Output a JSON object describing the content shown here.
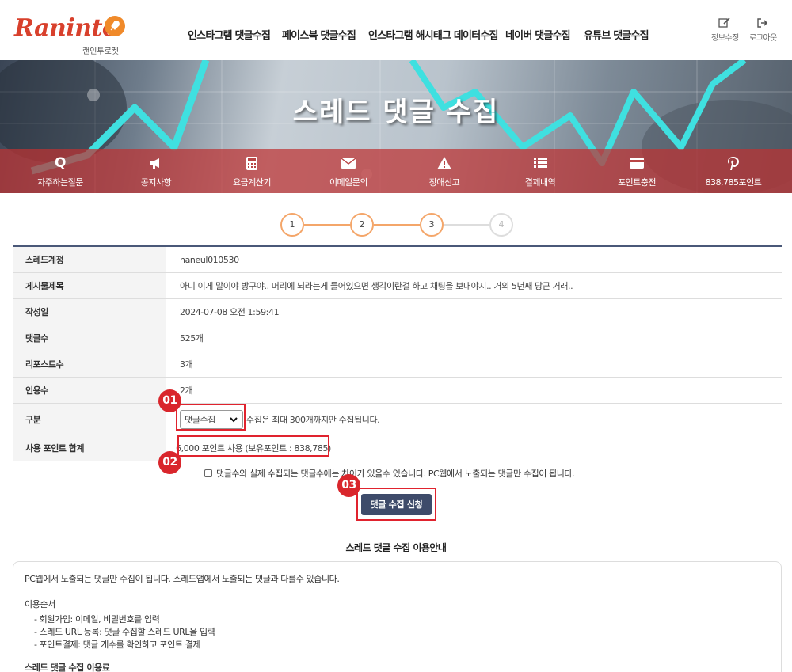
{
  "brand": {
    "logo_text": "Raninto",
    "sub_text": "랜인투로켓",
    "color": "#d8402c"
  },
  "nav": [
    "인스타그램 댓글수집",
    "페이스북 댓글수집",
    "인스타그램 해시태그 데이터수집",
    "네이버 댓글수집",
    "유튜브 댓글수집"
  ],
  "util": {
    "edit_label": "정보수정",
    "logout_label": "로그아웃"
  },
  "banner": {
    "title": "스레드 댓글 수집"
  },
  "quick_menu": [
    {
      "icon": "q-icon",
      "label": "자주하는질문"
    },
    {
      "icon": "megaphone-icon",
      "label": "공지사항"
    },
    {
      "icon": "calculator-icon",
      "label": "요금계산기"
    },
    {
      "icon": "envelope-icon",
      "label": "이메일문의"
    },
    {
      "icon": "warning-icon",
      "label": "장애신고"
    },
    {
      "icon": "list-icon",
      "label": "결제내역"
    },
    {
      "icon": "credit-card-icon",
      "label": "포인트충전"
    },
    {
      "icon": "pinterest-icon",
      "label": "838,785포인트"
    }
  ],
  "steps": {
    "items": [
      "1",
      "2",
      "3",
      "4"
    ],
    "current": 3,
    "active_color": "#f4a66a"
  },
  "info": {
    "account_label": "스레드계정",
    "account_value": "haneul010530",
    "title_label": "게시물제목",
    "title_value": "아니 이게 말이야 방구야.. 머리에 뇌라는게 들어있으면 생각이란걸 하고 채팅을 보내야지.. 거의 5년째 당근 거래..",
    "date_label": "작성일",
    "date_value": "2024-07-08 오전 1:59:41",
    "comments_label": "댓글수",
    "comments_value": "525개",
    "reposts_label": "리포스트수",
    "reposts_value": "3개",
    "quotes_label": "인용수",
    "quotes_value": "2개",
    "type_label": "구분",
    "type_selected": "댓글수집",
    "type_note": "수집은 최대 300개까지만 수집됩니다.",
    "points_label": "사용 포인트 합계",
    "points_value": "6,000 포인트 사용 (보유포인트 : 838,785)"
  },
  "badges": [
    "01",
    "02",
    "03"
  ],
  "notice": "댓글수와 실제 수집되는 댓글수에는 차이가 있을수 있습니다. PC웹에서 노출되는 댓글만 수집이 됩니다.",
  "submit_label": "댓글 수집 신청",
  "guide": {
    "title": "스레드 댓글 수집 이용안내",
    "intro": "PC웹에서 노출되는 댓글만 수집이 됩니다. 스레드앱에서 노출되는 댓글과 다를수 있습니다.",
    "order_title": "이용순서",
    "order_items": [
      "-   회원가입: 이메일, 비밀번호를 입력",
      "-   스레드 URL 등록: 댓글 수집할 스레드 URL을 입력",
      "-   포인트결제: 댓글 개수를 확인하고 포인트 결제"
    ],
    "fee_title": "스레드 댓글 수집 이용료"
  },
  "colors": {
    "highlight": "#e0232e",
    "submit_bg": "#3e4b6a",
    "table_top": "#4a5878"
  }
}
